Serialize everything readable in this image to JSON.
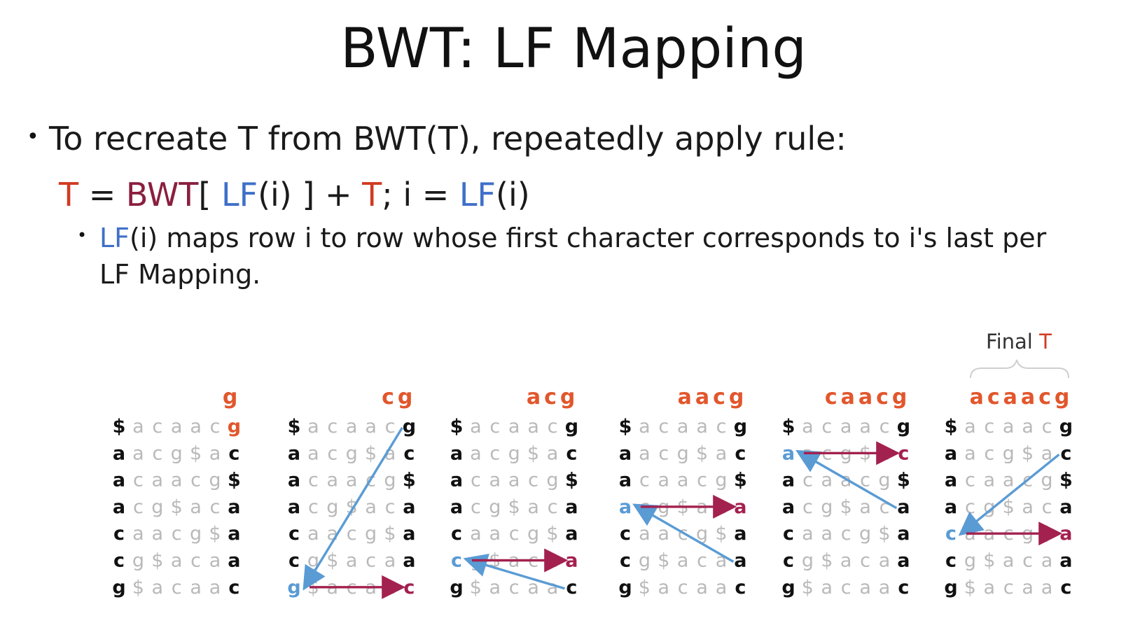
{
  "title": "BWT: LF Mapping",
  "bullet1": "To recreate T from BWT(T), repeatedly apply rule:",
  "rule": {
    "t": "T",
    "eq1": " = ",
    "bwt": "BWT",
    "open": "[ ",
    "lf1": "LF",
    "arg1": "(i) ] + ",
    "t2": "T",
    "mid": "; i = ",
    "lf2": "LF",
    "arg2": "(i)"
  },
  "bullet2": {
    "lf": "LF",
    "line1": "(i) maps row i to row whose first character corresponds to i's last per",
    "line2": "LF Mapping."
  },
  "final_label": {
    "text": "Final ",
    "t": "T"
  },
  "bwm_rows": [
    "$acaacg",
    "aacg$ac",
    "acaacg$",
    "acg$aca",
    "caacg$a",
    "cg$acaa",
    "g$acaac"
  ],
  "steps": [
    {
      "top": "g"
    },
    {
      "top": "cg"
    },
    {
      "top": "acg"
    },
    {
      "top": "aacg"
    },
    {
      "top": "caacg"
    },
    {
      "top": "acaacg"
    }
  ],
  "colors": {
    "red": "#d13a22",
    "orange": "#e2562c",
    "maroon": "#8a1f3f",
    "blue_text": "#3f70c8",
    "arrow_blue": "#5a9bd4",
    "arrow_maroon": "#a3214f",
    "gray": "#b9b9b9"
  }
}
